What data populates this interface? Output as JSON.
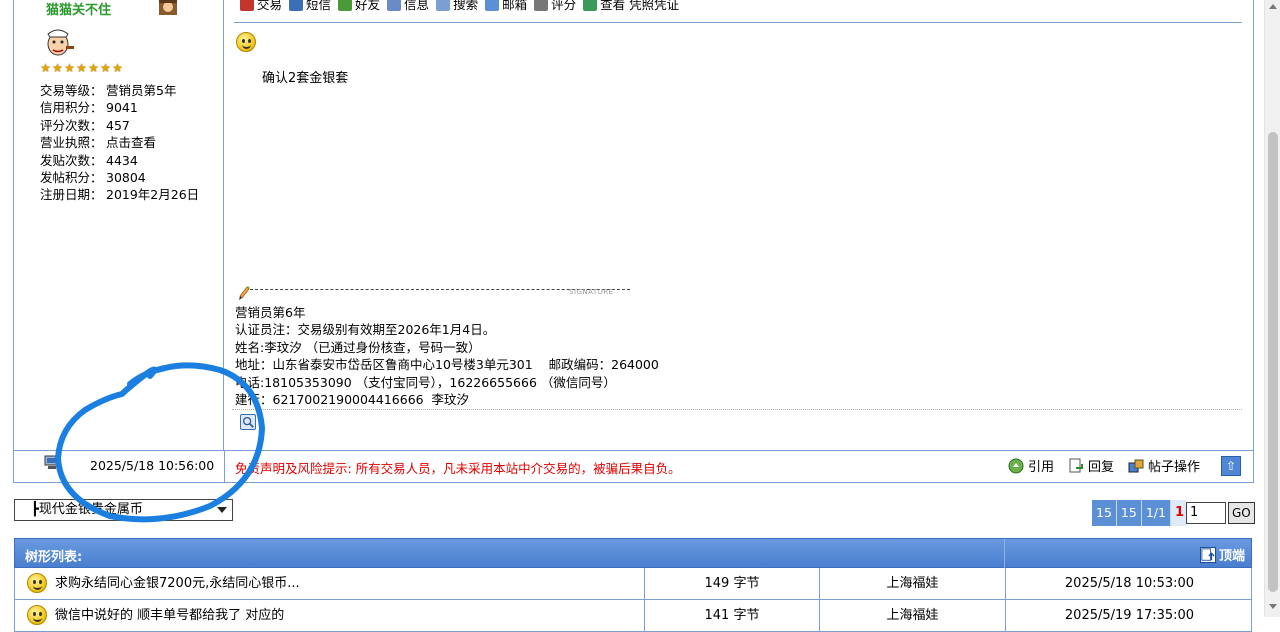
{
  "user": {
    "username": "猫猫关不住",
    "stars": 7,
    "info": [
      {
        "label": "交易等级：",
        "value": "营销员第5年"
      },
      {
        "label": "信用积分：",
        "value": "9041"
      },
      {
        "label": "评分次数：",
        "value": "457"
      },
      {
        "label": "营业执照：",
        "value": "点击查看"
      },
      {
        "label": "发贴次数：",
        "value": "4434"
      },
      {
        "label": "发帖积分：",
        "value": "30804"
      },
      {
        "label": "注册日期：",
        "value": "2019年2月26日"
      }
    ]
  },
  "toolbar": {
    "items": [
      {
        "label": "交易",
        "icon": "trade-icon"
      },
      {
        "label": "短信",
        "icon": "message-icon"
      },
      {
        "label": "好友",
        "icon": "friends-icon"
      },
      {
        "label": "信息",
        "icon": "info-icon"
      },
      {
        "label": "搜索",
        "icon": "search-icon"
      },
      {
        "label": "邮箱",
        "icon": "mail-icon"
      },
      {
        "label": "评分",
        "icon": "rate-icon"
      },
      {
        "label": "查看 凭照凭证",
        "icon": "license-icon"
      }
    ]
  },
  "post": {
    "body": "确认2套金银套",
    "signature_label": "SIGNATURE",
    "signature_lines": [
      "营销员第6年",
      "认证员注：交易级别有效期至2026年1月4日。",
      "姓名:李玟汐 （已通过身份核查，号码一致）",
      "地址：山东省泰安市岱岳区鲁商中心10号楼3单元301    邮政编码：264000",
      "电话:18105353090 （支付宝同号），16226655666 （微信同号）",
      "建行：6217002190004416666  李玟汐"
    ]
  },
  "footer": {
    "time": "2025/5/18 10:56:00",
    "disclaimer": "免责声明及风险提示:  所有交易人员，凡未采用本站中介交易的，被骗后果自负。",
    "actions": {
      "quote": "引用",
      "reply": "回复",
      "manage": "帖子操作"
    },
    "top_symbol": "⇧"
  },
  "forum_select": {
    "value": "┣现代金银贵金属币"
  },
  "pager": {
    "total": "15",
    "per_page": "15",
    "pages": "1/1",
    "current": "1",
    "input_value": "1",
    "go": "GO"
  },
  "tree": {
    "title": "树形列表:",
    "top_link": "顶端",
    "rows": [
      {
        "title": "求购永结同心金银7200元,永结同心银币...",
        "size": "149 字节",
        "author": "上海福娃",
        "time": "2025/5/18 10:53:00"
      },
      {
        "title": "微信中说好的 顺丰单号都给我了 对应的",
        "size": "141 字节",
        "author": "上海福娃",
        "time": "2025/5/19 17:35:00"
      }
    ]
  },
  "colors": {
    "border": "#7a9fd0",
    "header_blue": "#4a7fcf",
    "disclaimer_red": "#e00000",
    "username_green": "#2a9a2a",
    "scribble_blue": "#1a7fe0"
  }
}
